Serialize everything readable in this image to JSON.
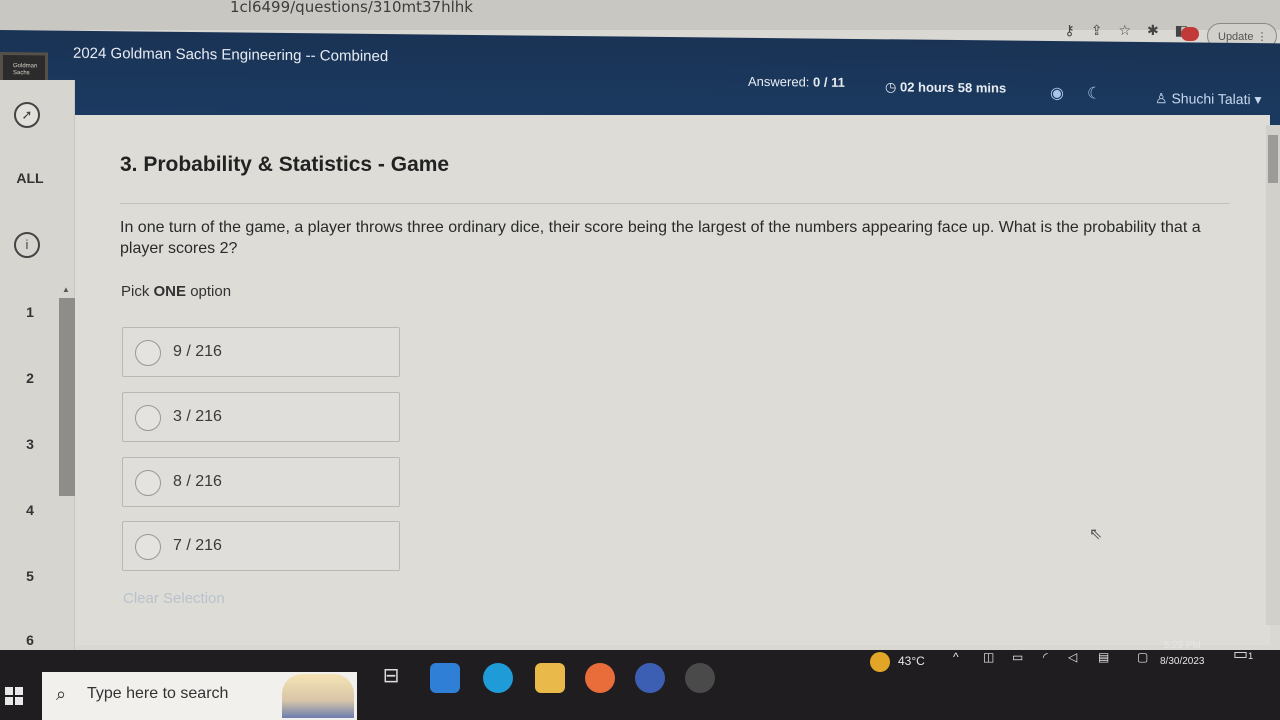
{
  "browser": {
    "url_fragment": "1cl6499/questions/310mt37hlhk",
    "update_label": "Update"
  },
  "header": {
    "test_title": "2024 Goldman Sachs Engineering -- Combined",
    "answered_label": "Answered:",
    "answered_value": "0 / 11",
    "timer": "02 hours 58 mins",
    "user_name": "Shuchi Talati"
  },
  "rail": {
    "all_label": "ALL",
    "questions": [
      "1",
      "2",
      "3",
      "4",
      "5",
      "6"
    ]
  },
  "question": {
    "title": "3. Probability & Statistics - Game",
    "text": "In one turn of the game, a player throws three ordinary dice, their score being the largest of the numbers appearing face up. What is the probability that a player scores 2?",
    "pick_prefix": "Pick",
    "pick_bold": "ONE",
    "pick_suffix": "option",
    "options": [
      "9 / 216",
      "3 / 216",
      "8 / 216",
      "7 / 216"
    ],
    "clear_selection": "Clear Selection"
  },
  "taskbar": {
    "search_placeholder": "Type here to search",
    "temperature": "43°C",
    "time": "5:29 PM",
    "date": "8/30/2023",
    "notification_count": "1"
  },
  "colors": {
    "header_bg": "#1b3a61",
    "accent_blue": "#aac4ea",
    "taskbar_bg": "#1f1d1f"
  }
}
